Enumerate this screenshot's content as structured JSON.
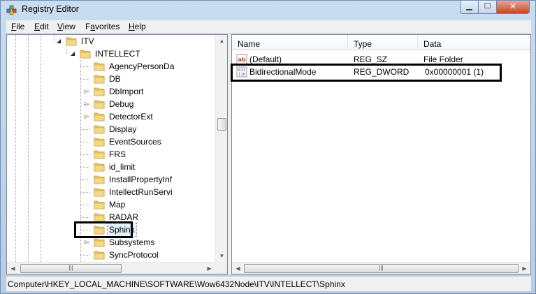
{
  "window": {
    "title": "Registry Editor"
  },
  "menu": [
    {
      "key": "F",
      "rest": "ile"
    },
    {
      "key": "E",
      "rest": "dit"
    },
    {
      "key": "V",
      "rest": "iew"
    },
    {
      "key": "",
      "pre": "F",
      "ukey": "a",
      "rest": "vorites"
    },
    {
      "key": "H",
      "rest": "elp"
    }
  ],
  "tree": {
    "nodes": [
      {
        "label": "ITV",
        "expanded": true
      },
      {
        "label": "INTELLECT",
        "expanded": true
      },
      {
        "label": "AgencyPersonDa",
        "has_children": false
      },
      {
        "label": "DB",
        "has_children": false
      },
      {
        "label": "DbImport",
        "has_children": true
      },
      {
        "label": "Debug",
        "has_children": true
      },
      {
        "label": "DetectorExt",
        "has_children": true
      },
      {
        "label": "Display",
        "has_children": false
      },
      {
        "label": "EventSources",
        "has_children": false
      },
      {
        "label": "FRS",
        "has_children": false
      },
      {
        "label": "id_limit",
        "has_children": false
      },
      {
        "label": "InstallPropertyInf",
        "has_children": false
      },
      {
        "label": "IntellectRunServi",
        "has_children": false
      },
      {
        "label": "Map",
        "has_children": false
      },
      {
        "label": "RADAR",
        "has_children": false
      },
      {
        "label": "Sphinx",
        "has_children": false,
        "selected": true
      },
      {
        "label": "Subsystems",
        "has_children": true
      },
      {
        "label": "SyncProtocol",
        "has_children": false
      }
    ]
  },
  "list": {
    "columns": {
      "name": "Name",
      "type": "Type",
      "data": "Data"
    },
    "rows": [
      {
        "name": "(Default)",
        "type": "REG_SZ",
        "data": "File Folder",
        "icon": "string-value-icon"
      },
      {
        "name": "BidirectionalMode",
        "type": "REG_DWORD",
        "data": "0x00000001 (1)",
        "icon": "dword-value-icon"
      }
    ]
  },
  "status": {
    "path": "Computer\\HKEY_LOCAL_MACHINE\\SOFTWARE\\Wow6432Node\\ITV\\INTELLECT\\Sphinx"
  },
  "colors": {
    "folder": "#e8c660",
    "folder_dark": "#c79a2a",
    "titlebar": "#c0d5ec",
    "close_button": "#c7432a"
  },
  "icons": {
    "app": "registry-editor-icon",
    "minimize": "minimize-icon",
    "maximize": "maximize-icon",
    "close": "close-icon",
    "folder": "folder-icon"
  }
}
